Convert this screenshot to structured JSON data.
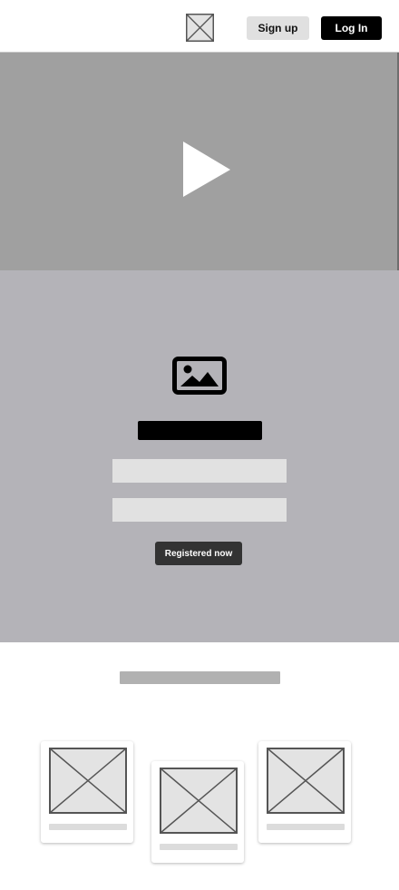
{
  "header": {
    "logo_icon": "placeholder-image-icon",
    "signup_label": "Sign up",
    "login_label": "Log In"
  },
  "hero": {
    "play_icon": "play-icon",
    "background_color": "#a0a0a0"
  },
  "register": {
    "image_icon": "image-icon",
    "button_label": "Registered now",
    "background_color": "#b4b3b8",
    "field_1_value": "",
    "field_2_value": ""
  },
  "cards": [
    {
      "image_icon": "placeholder-image-icon"
    },
    {
      "image_icon": "placeholder-image-icon"
    },
    {
      "image_icon": "placeholder-image-icon"
    }
  ]
}
